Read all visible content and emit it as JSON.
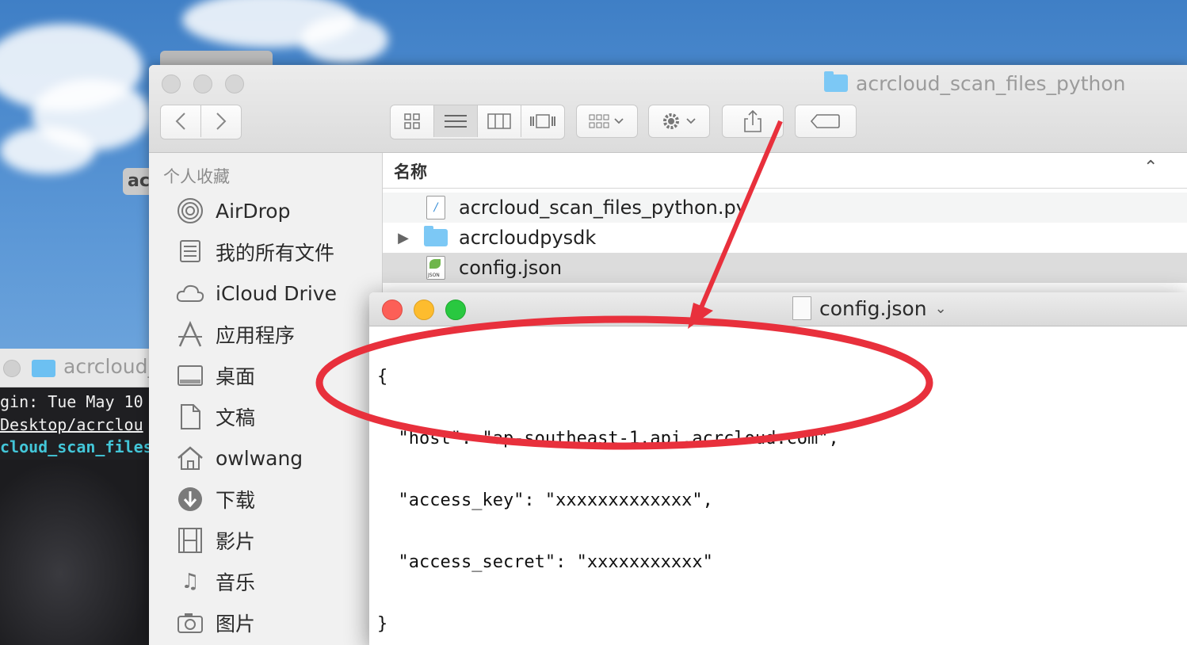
{
  "finder": {
    "title": "acrcloud_scan_files_python",
    "sidebar_header": "个人收藏",
    "sidebar_items": [
      {
        "label": "AirDrop",
        "icon": "airdrop-icon"
      },
      {
        "label": "我的所有文件",
        "icon": "all-files-icon"
      },
      {
        "label": "iCloud Drive",
        "icon": "cloud-icon"
      },
      {
        "label": "应用程序",
        "icon": "applications-icon"
      },
      {
        "label": "桌面",
        "icon": "desktop-icon"
      },
      {
        "label": "文稿",
        "icon": "documents-icon"
      },
      {
        "label": "owlwang",
        "icon": "home-icon"
      },
      {
        "label": "下载",
        "icon": "download-icon"
      },
      {
        "label": "影片",
        "icon": "movies-icon"
      },
      {
        "label": "音乐",
        "icon": "music-icon"
      },
      {
        "label": "图片",
        "icon": "pictures-icon"
      }
    ],
    "column_name": "名称",
    "files": [
      {
        "name": "acrcloud_scan_files_python.py",
        "icon": "python-file-icon"
      },
      {
        "name": "acrcloudpysdk",
        "icon": "folder-icon"
      },
      {
        "name": "config.json",
        "icon": "json-file-icon"
      }
    ]
  },
  "editor": {
    "title": "config.json",
    "lines": [
      "{",
      "  \"host\": \"ap-southeast-1.api.acrcloud.com\",",
      "  \"access_key\": \"xxxxxxxxxxxxx\",",
      "  \"access_secret\": \"xxxxxxxxxxx\"",
      "}"
    ]
  },
  "terminal": {
    "title": "acrcloud_",
    "lines": [
      "gin: Tue May 10",
      " Desktop/acrclou",
      "cloud_scan_files_"
    ]
  },
  "back_window_label": "ac",
  "colors": {
    "annotation": "#e8303c",
    "close": "#fc5f57",
    "minimize": "#fdbc2e",
    "zoom": "#29c840",
    "selection": "#dcdcdc"
  }
}
